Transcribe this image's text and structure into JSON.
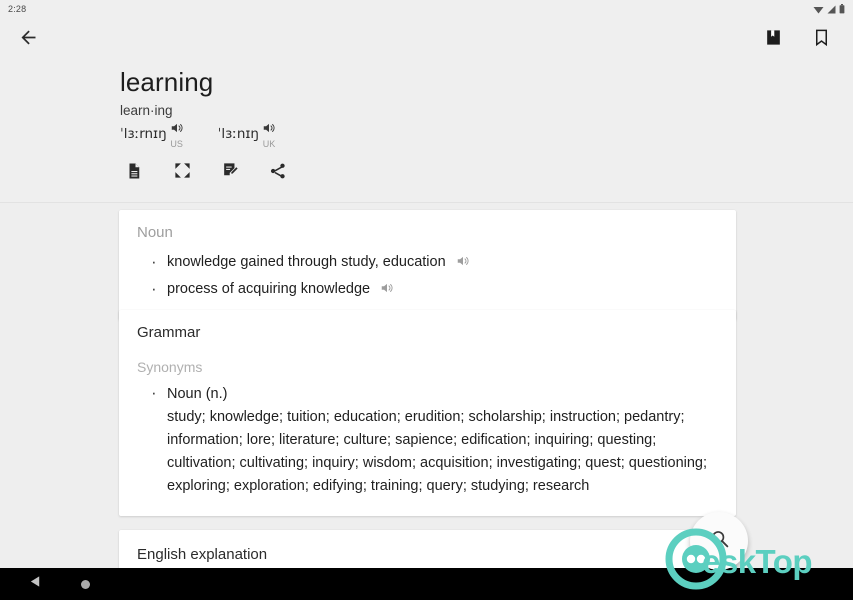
{
  "status_bar": {
    "time": "2:28",
    "icons": [
      "wifi-icon",
      "signal-icon",
      "battery-icon"
    ]
  },
  "app_bar": {
    "back_icon": "arrow-left-icon",
    "actions": [
      {
        "name": "dictionary-book-icon",
        "label": "Dictionary"
      },
      {
        "name": "bookmark-icon",
        "label": "Bookmark"
      }
    ]
  },
  "header": {
    "headword": "learning",
    "syllables": "learn·ing",
    "phonetics": [
      {
        "ipa": "ˈlɜːrnɪŋ",
        "region": "US",
        "speaker_icon": "speaker-icon"
      },
      {
        "ipa": "ˈlɜːnɪŋ",
        "region": "UK",
        "speaker_icon": "speaker-icon"
      }
    ],
    "tools": [
      {
        "name": "document-icon",
        "label": "Document"
      },
      {
        "name": "fullscreen-icon",
        "label": "Fullscreen"
      },
      {
        "name": "note-edit-icon",
        "label": "Note"
      },
      {
        "name": "share-icon",
        "label": "Share"
      }
    ]
  },
  "cards": {
    "noun": {
      "title": "Noun",
      "definitions": [
        "knowledge gained through study, education",
        "process of acquiring knowledge"
      ]
    },
    "grammar": {
      "title": "Grammar",
      "section_title": "Synonyms",
      "pos": "Noun (n.)",
      "synonyms": "study; knowledge; tuition; education; erudition; scholarship; instruction; pedantry; information; lore; literature; culture; sapience; edification; inquiring; questing; cultivation; cultivating; inquiry; wisdom; acquisition; investigating; quest; questioning; exploring; exploration; edifying; training; query; studying; research"
    },
    "english": {
      "title": "English explanation"
    }
  },
  "fab": {
    "name": "search-fab",
    "icon": "search-icon"
  },
  "watermark": {
    "text": "eskTop",
    "color": "#5ccfc0"
  },
  "nav_bar": {
    "back_icon": "nav-back-triangle-icon",
    "home_icon": "nav-home-circle-icon"
  }
}
